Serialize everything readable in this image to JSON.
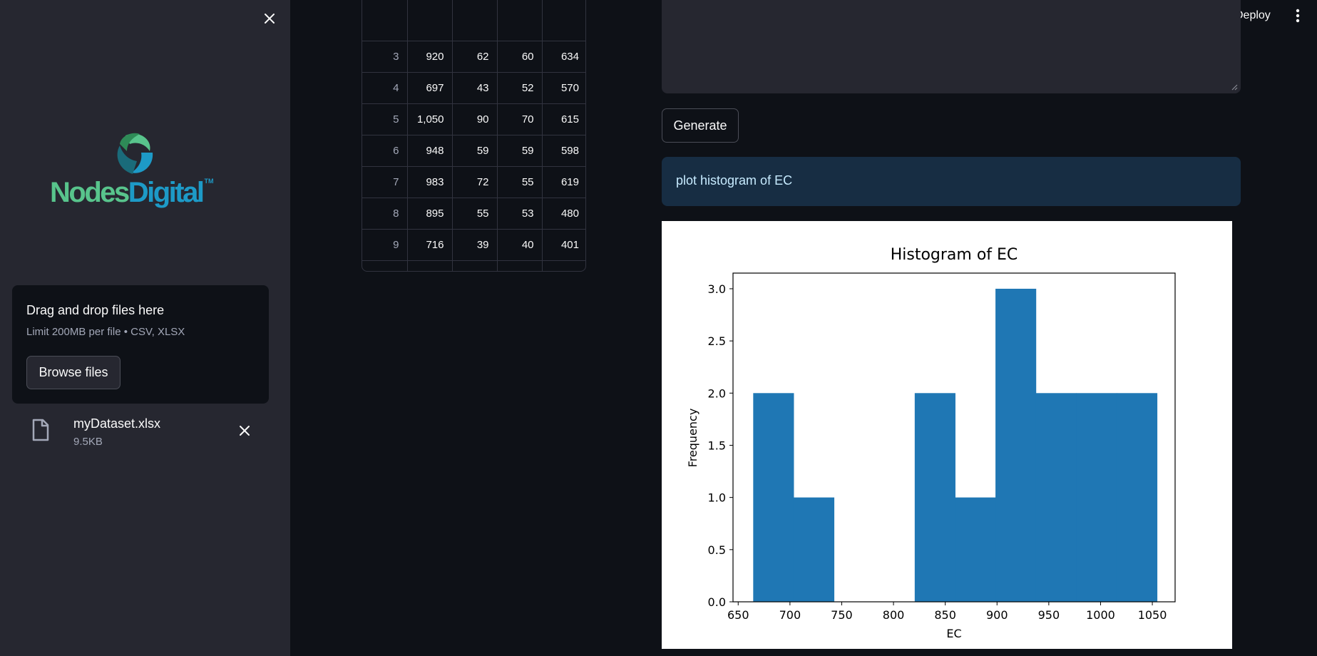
{
  "topbar": {
    "deploy_label": "Deploy"
  },
  "sidebar": {
    "logo": {
      "word1": "Nodes",
      "word2": "Digital",
      "tm": "TM"
    },
    "uploader": {
      "title": "Drag and drop files here",
      "subtitle": "Limit 200MB per file • CSV, XLSX",
      "browse_label": "Browse files"
    },
    "file": {
      "name": "myDataset.xlsx",
      "size": "9.5KB"
    }
  },
  "table": {
    "rows": [
      [
        "3",
        "920",
        "62",
        "60",
        "634"
      ],
      [
        "4",
        "697",
        "43",
        "52",
        "570"
      ],
      [
        "5",
        "1,050",
        "90",
        "70",
        "615"
      ],
      [
        "6",
        "948",
        "59",
        "59",
        "598"
      ],
      [
        "7",
        "983",
        "72",
        "55",
        "619"
      ],
      [
        "8",
        "895",
        "55",
        "53",
        "480"
      ],
      [
        "9",
        "716",
        "39",
        "40",
        "401"
      ]
    ]
  },
  "query": {
    "generate_label": "Generate",
    "prompt": "plot histogram of EC"
  },
  "colors": {
    "accent_bar": "#1f77b4",
    "prompt_bg": "#172d43",
    "sidebar_bg": "#262730",
    "app_bg": "#0e1117"
  },
  "chart_data": {
    "type": "bar",
    "title": "Histogram of EC",
    "xlabel": "EC",
    "ylabel": "Frequency",
    "xlim": [
      645,
      1072
    ],
    "ylim": [
      0,
      3.15
    ],
    "xticks": [
      650,
      700,
      750,
      800,
      850,
      900,
      950,
      1000,
      1050
    ],
    "yticks": [
      "0.0",
      "0.5",
      "1.0",
      "1.5",
      "2.0",
      "2.5",
      "3.0"
    ],
    "bins": [
      {
        "start": 664.5,
        "end": 703.5,
        "count": 2
      },
      {
        "start": 703.5,
        "end": 742.5,
        "count": 1
      },
      {
        "start": 742.5,
        "end": 781.5,
        "count": 0
      },
      {
        "start": 781.5,
        "end": 820.5,
        "count": 0
      },
      {
        "start": 820.5,
        "end": 859.5,
        "count": 2
      },
      {
        "start": 859.5,
        "end": 898.5,
        "count": 1
      },
      {
        "start": 898.5,
        "end": 937.5,
        "count": 3
      },
      {
        "start": 937.5,
        "end": 976.5,
        "count": 2
      },
      {
        "start": 976.5,
        "end": 1015.5,
        "count": 2
      },
      {
        "start": 1015.5,
        "end": 1054.5,
        "count": 2
      }
    ]
  }
}
